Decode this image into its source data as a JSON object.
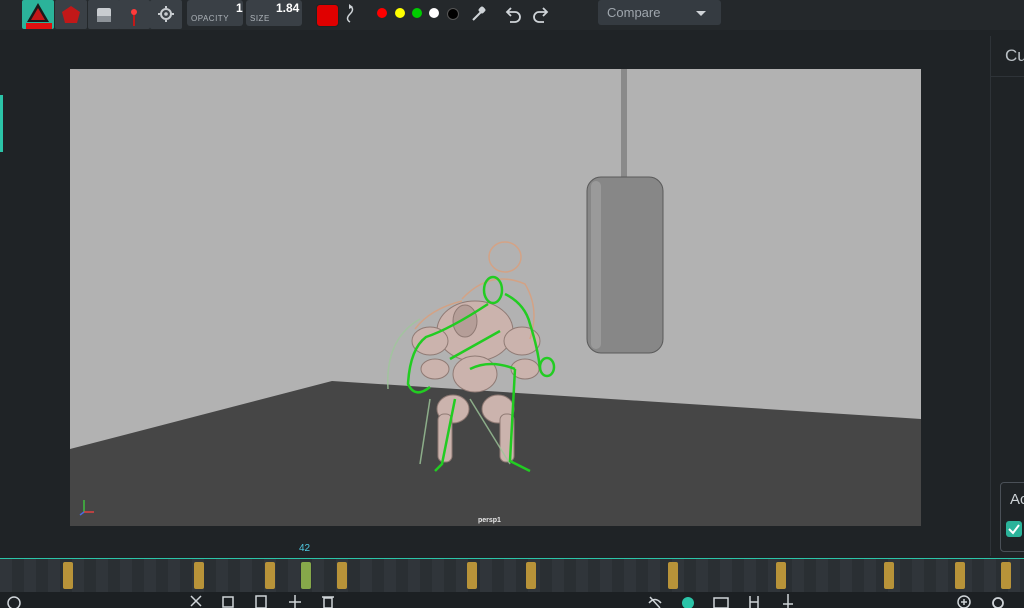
{
  "toolbar": {
    "tools": [
      {
        "icon": "triangle-pen-icon",
        "active": true
      },
      {
        "icon": "polygon-shape-icon",
        "active": false
      },
      {
        "icon": "eraser-icon",
        "active": false
      },
      {
        "icon": "laser-pointer-icon",
        "active": false
      },
      {
        "icon": "gear-icon",
        "active": false
      }
    ],
    "opacity": {
      "label": "OPACITY",
      "value": "1"
    },
    "size": {
      "label": "SIZE",
      "value": "1.84"
    },
    "current_color": "#e00000",
    "palette": [
      "#ff0000",
      "#ffff00",
      "#00cc00",
      "#ffffff",
      "#000000"
    ],
    "compare": {
      "label": "Compare"
    }
  },
  "right_panel": {
    "title": "Cu",
    "card_label": "Ac"
  },
  "viewport": {
    "camera_label": "persp1"
  },
  "timeline": {
    "current_frame": "42",
    "accent": "#2bc4a8",
    "keyframe_color": "#b89339"
  }
}
